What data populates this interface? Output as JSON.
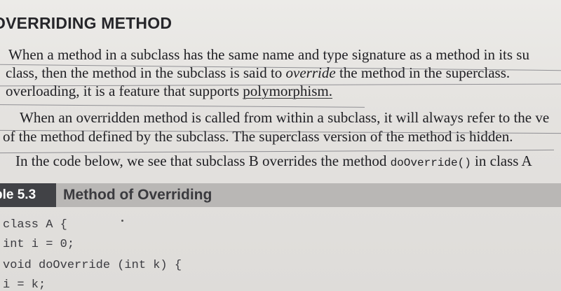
{
  "section": {
    "heading": "OVERRIDING METHOD"
  },
  "paragraphs": [
    {
      "lines": [
        "When a method in a subclass has the same name and type signature as a method in its su",
        {
          "before": "class, then the method in the subclass is said to ",
          "emph": "override",
          "after": " the method in the superclass."
        },
        {
          "before": "overloading, it is a feature that supports ",
          "underlined": "polymorphism."
        }
      ]
    },
    {
      "lines": [
        "When an overridden method is called from within a subclass, it will always refer to the ve",
        "of the method defined by the subclass. The superclass version of the method is hidden."
      ]
    },
    {
      "before": "In the code below, we see that subclass B overrides the method ",
      "code": "doOverride()",
      "after": " in class A"
    }
  ],
  "table": {
    "label": "ble 5.3",
    "title": "Method of Overriding"
  },
  "code": [
    "class A {",
    "int i = 0;",
    "void doOverride (int k) {",
    "i = k;"
  ]
}
